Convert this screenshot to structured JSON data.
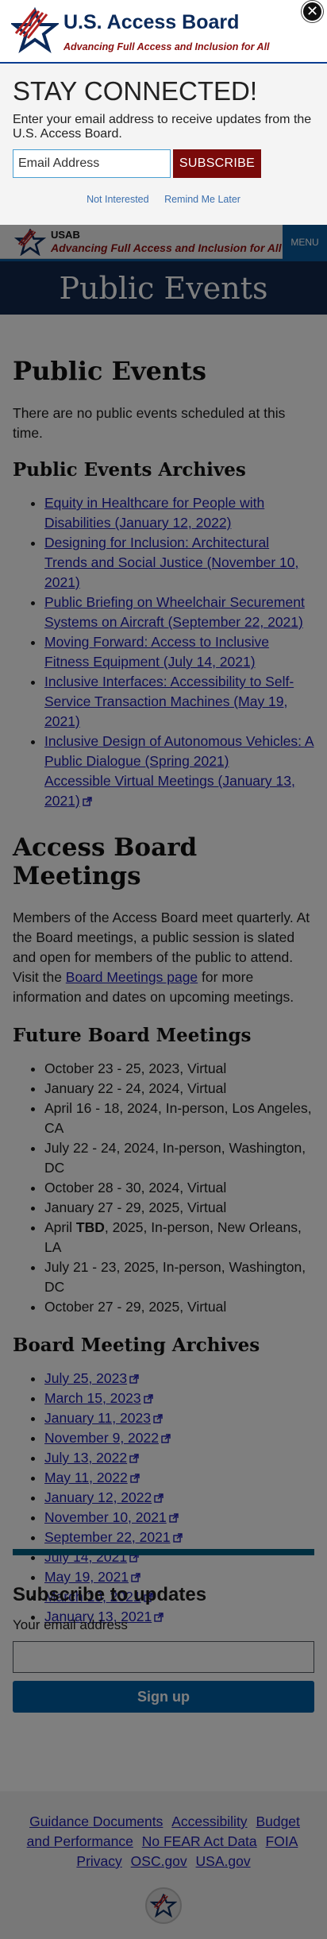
{
  "modal": {
    "logo_title": "U.S. Access Board",
    "logo_tagline": "Advancing Full Access and Inclusion for All",
    "close_label": "✕",
    "heading": "STAY CONNECTED!",
    "text": "Enter your email address to receive updates from the U.S. Access Board.",
    "email_placeholder": "Email Address",
    "subscribe_label": "SUBSCRIBE",
    "not_interested": "Not Interested",
    "remind_later": "Remind Me Later"
  },
  "header": {
    "abbr": "USAB",
    "tagline": "Advancing Full Access and Inclusion for All",
    "menu_label": "MENU"
  },
  "hero": {
    "title": "Public Events"
  },
  "main": {
    "title": "Public Events",
    "no_events": "There are no public events scheduled at this time.",
    "archives_heading": "Public Events Archives",
    "archives": [
      "Equity in Healthcare for People with Disabilities (January 12, 2022)",
      "Designing for Inclusion: Architectural Trends and Social Justice (November 10, 2021)",
      "Public Briefing on Wheelchair Securement Systems on Aircraft (September 22, 2021)",
      "Moving Forward: Access to Inclusive Fitness Equipment (July 14, 2021)",
      "Inclusive Interfaces: Accessibility to Self-Service Transaction Machines (May 19, 2021)",
      "Inclusive Design of Autonomous Vehicles: A Public Dialogue (Spring 2021)",
      "Accessible Virtual Meetings (January 13, 2021)"
    ],
    "meetings_heading": "Access Board Meetings",
    "meetings_text_before": "Members of the Access Board meet quarterly. At the Board meetings, a public session is slated and open for members of the public to attend. Visit the ",
    "meetings_link": "Board Meetings page",
    "meetings_text_after": " for more information and dates on upcoming meetings.",
    "future_heading": "Future Board Meetings",
    "future": [
      "October 23 - 25, 2023, Virtual",
      "January 22 - 24, 2024, Virtual",
      "April 16 - 18, 2024, In-person, Los Angeles, CA",
      "July 22 - 24, 2024, In-person, Washington, DC",
      "October 28 - 30, 2024, Virtual",
      "January 27 - 29, 2025, Virtual",
      "July 21 - 23, 2025, In-person, Washington, DC",
      "October 27 - 29, 2025, Virtual"
    ],
    "future_tbd": {
      "prefix": "April ",
      "bold": "TBD",
      "suffix": ", 2025, In-person, New Orleans, LA"
    },
    "board_archives_heading": "Board Meeting Archives",
    "board_archives": [
      "July 25, 2023",
      "March 15, 2023",
      "January 11, 2023",
      "November 9, 2022",
      "July 13, 2022",
      "May 11, 2022",
      "January 12, 2022",
      "November 10, 2021",
      "September 22, 2021",
      "July 14, 2021",
      "May 19, 2021",
      "March 10, 2021",
      "January 13, 2021"
    ]
  },
  "subscribe": {
    "title": "Subscribe to updates",
    "label": "Your email address",
    "button": "Sign up"
  },
  "footer": {
    "links": [
      "Guidance Documents",
      "Accessibility",
      "Budget and Performance",
      "No FEAR Act Data",
      "FOIA",
      "Privacy",
      "OSC.gov",
      "USA.gov"
    ]
  },
  "colors": {
    "brand_navy": "#0b2a5b",
    "brand_red": "#8b1111",
    "subscribe_red": "#7a0a0a",
    "link_blue": "#1a1aa8",
    "hero_bg": "#12284c",
    "signup_blue": "#005ea2"
  }
}
